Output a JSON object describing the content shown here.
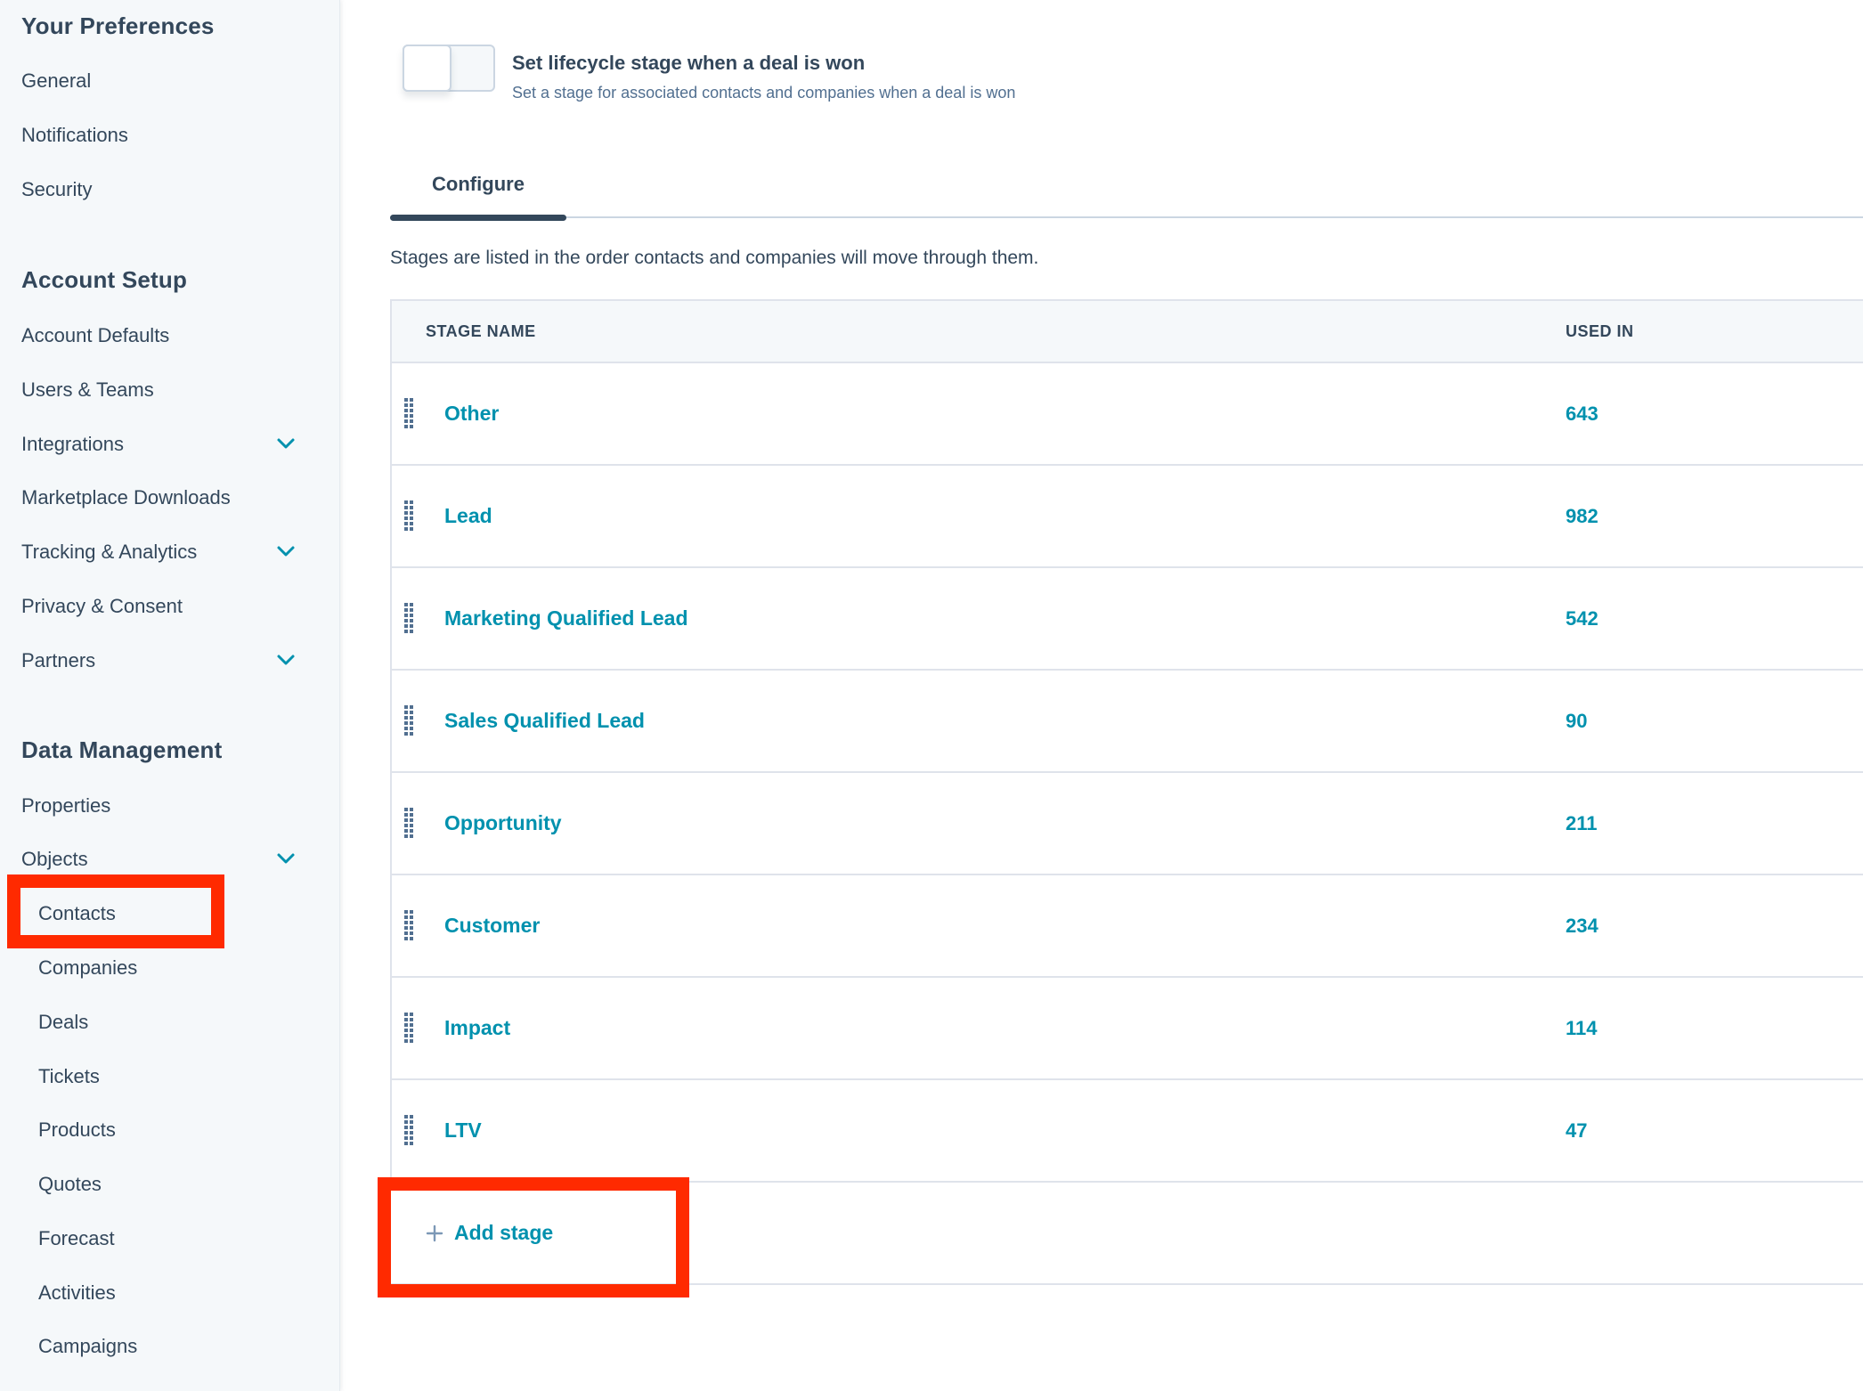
{
  "sidebar": {
    "sections": [
      {
        "heading": "Your Preferences",
        "items": [
          {
            "label": "General"
          },
          {
            "label": "Notifications"
          },
          {
            "label": "Security"
          }
        ]
      },
      {
        "heading": "Account Setup",
        "items": [
          {
            "label": "Account Defaults"
          },
          {
            "label": "Users & Teams"
          },
          {
            "label": "Integrations",
            "expandable": true
          },
          {
            "label": "Marketplace Downloads"
          },
          {
            "label": "Tracking & Analytics",
            "expandable": true
          },
          {
            "label": "Privacy & Consent"
          },
          {
            "label": "Partners",
            "expandable": true
          }
        ]
      },
      {
        "heading": "Data Management",
        "items": [
          {
            "label": "Properties"
          },
          {
            "label": "Objects",
            "expandable": true,
            "expanded": true
          }
        ],
        "sub_items": [
          {
            "label": "Contacts",
            "selected": true
          },
          {
            "label": "Companies"
          },
          {
            "label": "Deals"
          },
          {
            "label": "Tickets"
          },
          {
            "label": "Products"
          },
          {
            "label": "Quotes"
          },
          {
            "label": "Forecast"
          },
          {
            "label": "Activities"
          },
          {
            "label": "Campaigns"
          }
        ]
      }
    ]
  },
  "toggle": {
    "state": "off",
    "title": "Set lifecycle stage when a deal is won",
    "description": "Set a stage for associated contacts and companies when a deal is won"
  },
  "tabs": [
    {
      "label": "Configure",
      "active": true
    }
  ],
  "intro_text": "Stages are listed in the order contacts and companies will move through them.",
  "table": {
    "columns": [
      "STAGE NAME",
      "USED IN"
    ],
    "rows": [
      {
        "name": "Other",
        "used_in": "643"
      },
      {
        "name": "Lead",
        "used_in": "982"
      },
      {
        "name": "Marketing Qualified Lead",
        "used_in": "542"
      },
      {
        "name": "Sales Qualified Lead",
        "used_in": "90"
      },
      {
        "name": "Opportunity",
        "used_in": "211"
      },
      {
        "name": "Customer",
        "used_in": "234"
      },
      {
        "name": "Impact",
        "used_in": "114"
      },
      {
        "name": "LTV",
        "used_in": "47"
      }
    ],
    "add_label": "Add stage"
  },
  "annotations": [
    {
      "target": "Contacts",
      "color": "#ff2a00"
    },
    {
      "target": "Add stage",
      "color": "#ff2a00"
    }
  ],
  "colors": {
    "accent": "#0091ae",
    "text": "#33475b",
    "sidebar_bg": "#f5f8fa",
    "annotation": "#ff2a00"
  }
}
